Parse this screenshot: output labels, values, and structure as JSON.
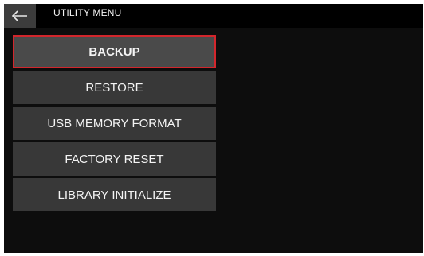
{
  "header": {
    "title": "UTILITY MENU",
    "back_icon": "left-arrow-icon"
  },
  "menu": {
    "selected_index": 0,
    "accent_color": "#d2262c",
    "items": [
      {
        "label": "BACKUP"
      },
      {
        "label": "RESTORE"
      },
      {
        "label": "USB MEMORY FORMAT"
      },
      {
        "label": "FACTORY RESET"
      },
      {
        "label": "LIBRARY INITIALIZE"
      }
    ]
  }
}
